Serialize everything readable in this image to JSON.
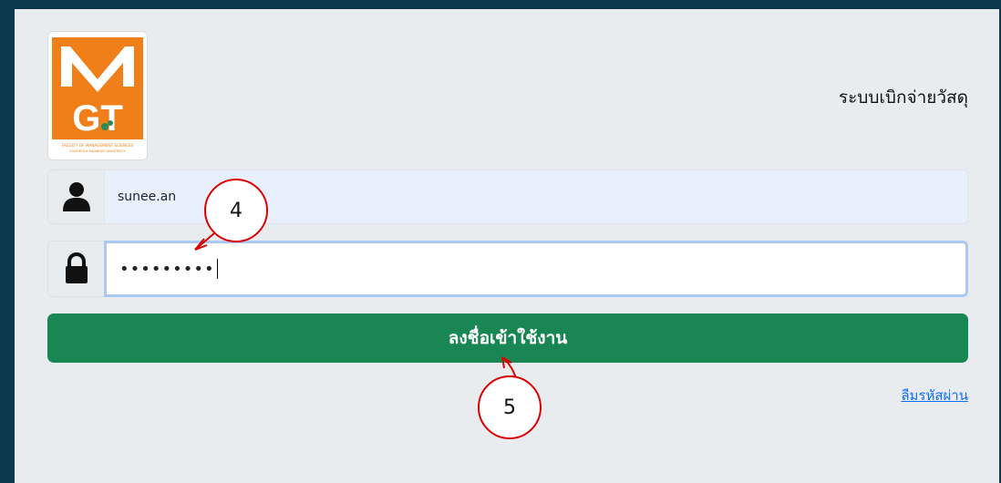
{
  "header": {
    "system_title": "ระบบเบิกจ่ายวัสดุ",
    "logo": {
      "letters_top": "M",
      "letters_bottom": "GT",
      "caption_line1": "FACULTY OF MANAGEMENT SCIENCES",
      "caption_line2": "SONGKHLA RAJABHAT UNIVERSITY"
    }
  },
  "form": {
    "username_icon": "user-icon",
    "username_value": "sunee.an",
    "password_icon": "lock-icon",
    "password_value": "•••••••••",
    "login_label": "ลงชื่อเข้าใช้งาน",
    "forgot_label": "ลืมรหัสผ่าน"
  },
  "annotations": {
    "callout_password": "4",
    "callout_button": "5"
  },
  "colors": {
    "button": "#198754",
    "focus_border": "#a9c8f4",
    "callout_border": "#dd0000"
  }
}
